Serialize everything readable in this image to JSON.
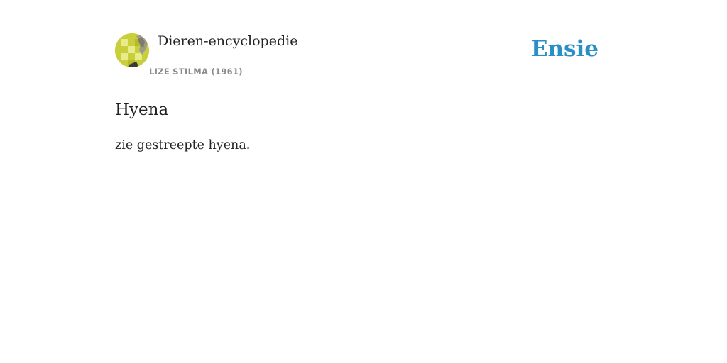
{
  "header": {
    "book_title": "Dieren-encyclopedie",
    "author": "LIZE STILMA (1961)",
    "brand": "Ensie",
    "avatar_icon": "book-cover-thumbnail",
    "avatar_colors": [
      "#c8cf3a",
      "#e6e98a",
      "#9a9a8a"
    ]
  },
  "entry": {
    "title": "Hyena",
    "body": "zie gestreepte hyena."
  },
  "colors": {
    "brand": "#2a8ec7",
    "text": "#222222",
    "muted": "#8a8a8a",
    "divider": "#d8d8d8"
  }
}
